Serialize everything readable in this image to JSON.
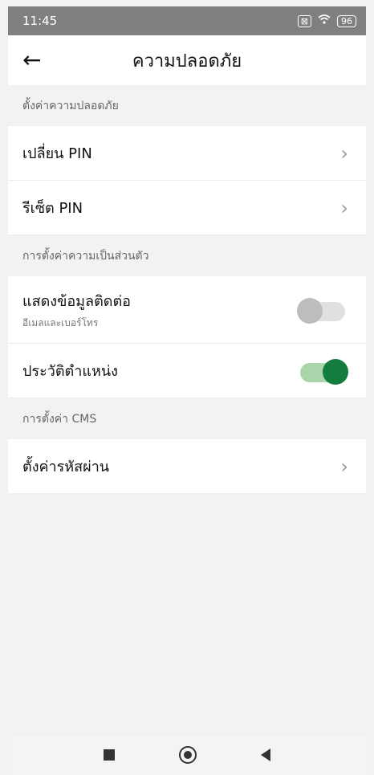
{
  "statusbar": {
    "time": "11:45",
    "box_icon": "⊠",
    "wifi_icon": "wifi",
    "battery": "96"
  },
  "header": {
    "title": "ความปลอดภัย"
  },
  "sections": [
    {
      "title": "ตั้งค่าความปลอดภัย",
      "items": [
        {
          "label": "เปลี่ยน PIN"
        },
        {
          "label": "รีเซ็ต PIN"
        }
      ]
    },
    {
      "title": "การตั้งค่าความเป็นส่วนตัว",
      "items": [
        {
          "label": "แสดงข้อมูลติดต่อ",
          "sublabel": "อีเมลและเบอร์โทร",
          "toggle": false
        },
        {
          "label": "ประวัติตำแหน่ง",
          "toggle": true
        }
      ]
    },
    {
      "title": "การตั้งค่า CMS",
      "items": [
        {
          "label": "ตั้งค่ารหัสผ่าน"
        }
      ]
    }
  ],
  "colors": {
    "toggle_on": "#137c3f",
    "toggle_on_track": "#a8d5a9",
    "toggle_off": "#bdbdbd"
  }
}
